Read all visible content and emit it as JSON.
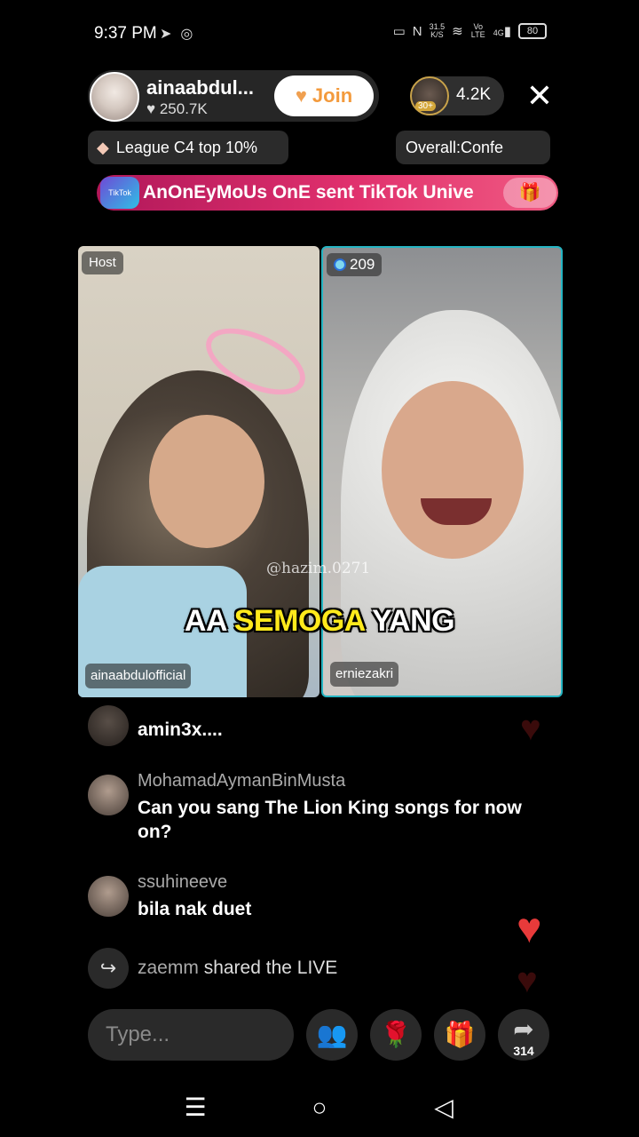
{
  "status_bar": {
    "time": "9:37 PM",
    "net_speed_value": "31.5",
    "net_speed_unit": "K/S",
    "volte": "Vo LTE",
    "signal": "4G",
    "battery": "80"
  },
  "host": {
    "name": "ainaabdul...",
    "likes": "250.7K",
    "join_label": "Join"
  },
  "viewers": {
    "badge": "30+",
    "count": "4.2K"
  },
  "league": {
    "label": "League C4 top 10%"
  },
  "overall": {
    "label": "Overall:Confe"
  },
  "gift_banner": {
    "icon_text": "TikTok Universe",
    "text": "AnOnEyMoUs OnE sent TikTok Unive"
  },
  "battle": {
    "left": {
      "tag": "Host",
      "name": "ainaabdulofficial"
    },
    "right": {
      "score": "209",
      "name": "erniezakri"
    }
  },
  "watermark": "@hazim.0271",
  "caption": {
    "word1": "AA",
    "word2": "SEMOGA",
    "word3": "YANG"
  },
  "comments": [
    {
      "user": "",
      "text": "amin3x...."
    },
    {
      "user": "MohamadAymanBinMusta",
      "text": "Can you sang The Lion King songs for now on?"
    },
    {
      "user": "ssuhineeve",
      "text": "bila nak duet"
    }
  ],
  "share_event": {
    "user": "zaemm",
    "text": "shared the LIVE"
  },
  "input": {
    "placeholder": "Type..."
  },
  "share_count": "314",
  "colors": {
    "accent_join": "#f39a3c",
    "gift_banner": "#e0306d",
    "caption_highlight": "#ffea1c",
    "battle_border": "#25b5c3",
    "heart": "#e83a3a"
  },
  "icons": [
    "telegram-icon",
    "cast-icon",
    "nfc-icon",
    "wifi-icon",
    "heart-icon",
    "gem-icon",
    "gift-icon",
    "close-icon",
    "share-icon",
    "people-icon",
    "rose-icon",
    "menu-icon",
    "home-icon",
    "back-icon"
  ]
}
